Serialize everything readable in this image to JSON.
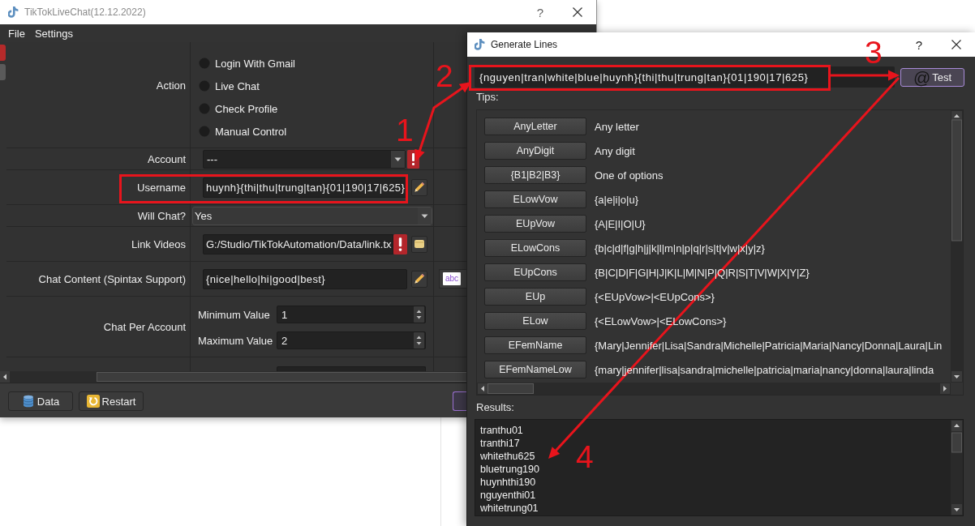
{
  "main_window": {
    "title": "TikTokLiveChat(12.12.2022)",
    "help_button": "?",
    "menu": [
      {
        "label": "File"
      },
      {
        "label": "Settings"
      }
    ],
    "side_tabs": [
      {
        "selected": true
      },
      {
        "selected": false
      }
    ],
    "form": {
      "rows": [
        {
          "kind": "radio_group",
          "label": "Action",
          "options": [
            {
              "label": "Login With Gmail",
              "selected": false
            },
            {
              "label": "Live Chat",
              "selected": false
            },
            {
              "label": "Check Profile",
              "selected": false
            },
            {
              "label": "Manual Control",
              "selected": false
            }
          ]
        },
        {
          "kind": "combo",
          "label": "Account",
          "value": "---",
          "warning": true
        },
        {
          "kind": "text",
          "label": "Username",
          "value": "huynh}{thi|thu|trung|tan}{01|190|17|625}",
          "button": {
            "kind": "edit"
          }
        },
        {
          "kind": "wide_combo",
          "label": "Will Chat?",
          "value": "Yes"
        },
        {
          "kind": "text",
          "label": "Link Videos",
          "value": "G:/Studio/TikTokAutomation/Data/link.tx",
          "warning": true,
          "button": {
            "kind": "browse"
          }
        },
        {
          "kind": "text",
          "label": "Chat Content (Spintax Support)",
          "value": "{nice|hello|hi|good|best}",
          "button": {
            "kind": "edit"
          },
          "extra_button": "abc"
        },
        {
          "kind": "spin_pair",
          "label": "Chat Per Account",
          "fields": [
            {
              "label": "Minimum Value",
              "value": "1"
            },
            {
              "label": "Maximum Value",
              "value": "2"
            }
          ]
        },
        {
          "kind": "spin_cut"
        }
      ]
    },
    "footer_buttons": [
      {
        "kind": "data",
        "label": "Data"
      },
      {
        "kind": "restart",
        "label": "Restart"
      },
      {
        "kind": "accent"
      }
    ]
  },
  "dialog": {
    "title": "Generate Lines",
    "help_button": "?",
    "pattern": "{nguyen|tran|white|blue|huynh}{thi|thu|trung|tan}{01|190|17|625}",
    "test_button": {
      "icon": "@",
      "label": "Test"
    },
    "tips_label": "Tips:",
    "tips": [
      {
        "button": "AnyLetter",
        "description": "Any letter"
      },
      {
        "button": "AnyDigit",
        "description": "Any digit"
      },
      {
        "button": "{B1|B2|B3}",
        "description": "One of options"
      },
      {
        "button": "ELowVow",
        "description": "{a|e|i|o|u}"
      },
      {
        "button": "EUpVow",
        "description": "{A|E|I|O|U}"
      },
      {
        "button": "ELowCons",
        "description": "{b|c|d|f|g|h|j|k|l|m|n|p|q|r|s|t|v|w|x|y|z}"
      },
      {
        "button": "EUpCons",
        "description": "{B|C|D|F|G|H|J|K|L|M|N|P|Q|R|S|T|V|W|X|Y|Z}"
      },
      {
        "button": "EUp",
        "description": "{<EUpVow>|<EUpCons>}"
      },
      {
        "button": "ELow",
        "description": "{<ELowVow>|<ELowCons>}"
      },
      {
        "button": "EFemName",
        "description": "{Mary|Jennifer|Lisa|Sandra|Michelle|Patricia|Maria|Nancy|Donna|Laura|Lin"
      },
      {
        "button": "EFemNameLow",
        "description": "{mary|jennifer|lisa|sandra|michelle|patricia|maria|nancy|donna|laura|linda"
      }
    ],
    "results_label": "Results:",
    "results": [
      "tranthu01",
      "tranthi17",
      "whitethu625",
      "bluetrung190",
      "huynhthi190",
      "nguyenthi01",
      "whitetrung01"
    ]
  },
  "annotations": {
    "steps": [
      "1",
      "2",
      "3",
      "4"
    ]
  }
}
